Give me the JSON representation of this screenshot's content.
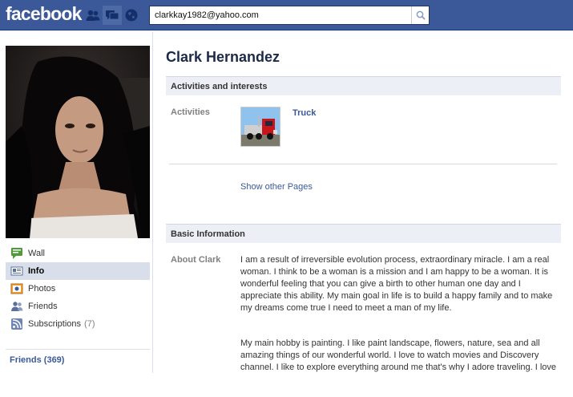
{
  "header": {
    "logo": "facebook",
    "search_value": "clarkkay1982@yahoo.com",
    "jewels": [
      "friend-requests-icon",
      "messages-icon",
      "notifications-icon"
    ],
    "brand_color": "#3b5998"
  },
  "profile": {
    "name": "Clark Hernandez",
    "nav": [
      {
        "label": "Wall",
        "icon": "wall-icon"
      },
      {
        "label": "Info",
        "icon": "info-icon",
        "selected": true
      },
      {
        "label": "Photos",
        "icon": "photos-icon"
      },
      {
        "label": "Friends",
        "icon": "friends-icon"
      },
      {
        "label": "Subscriptions",
        "icon": "subscriptions-icon",
        "count": "(7)"
      }
    ],
    "friends_link": "Friends (369)"
  },
  "activities": {
    "heading": "Activities and interests",
    "label": "Activities",
    "item": "Truck",
    "show_other": "Show other Pages"
  },
  "basic": {
    "heading": "Basic Information",
    "label": "About Clark",
    "paragraph1": "I am a result of irreversible evolution process, extraordinary miracle. I am a real woman. I think to be a woman is a mission and I am happy to be a woman. It is wonderful feeling that you can give a birth to other human one day and I appreciate this ability. My main goal in life is to build a happy family and to make my dreams come true I need to meet a man of my life.",
    "paragraph2": "My main hobby is painting. I like paint landscape, flowers, nature, sea and all amazing things of our wonderful world. I love to watch movies and Discovery channel. I like to explore everything around me that's why I adore traveling. I love"
  }
}
